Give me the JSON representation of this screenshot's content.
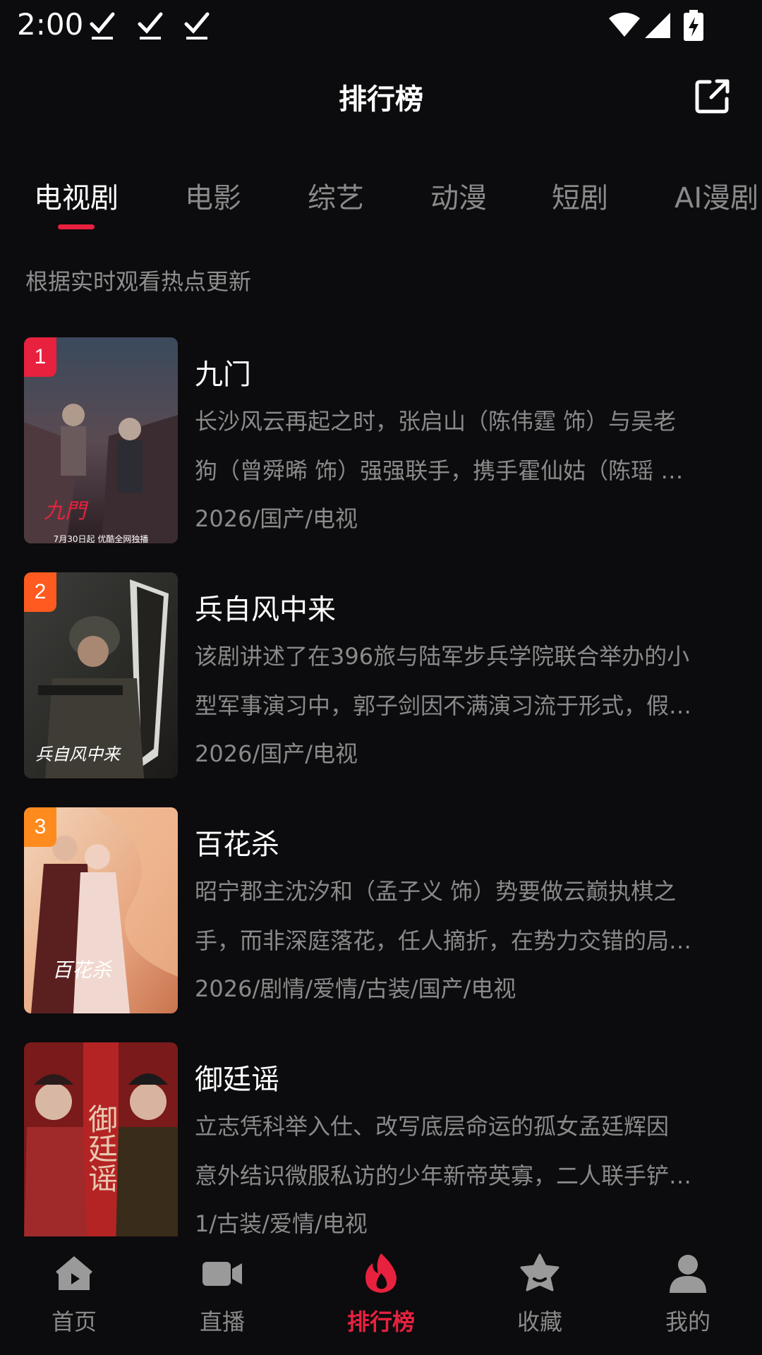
{
  "status_bar": {
    "time": "2:00",
    "icons": [
      "download-done-icon",
      "download-done-icon",
      "download-done-icon",
      "wifi-icon",
      "signal-icon",
      "battery-charging-icon"
    ]
  },
  "header": {
    "title": "排行榜",
    "share_icon": "share-external-icon"
  },
  "tabs": [
    "电视剧",
    "电影",
    "综艺",
    "动漫",
    "短剧",
    "AI漫剧"
  ],
  "active_tab": "电视剧",
  "subtitle": "根据实时观看热点更新",
  "colors": {
    "accent": "#e8213f",
    "background": "#0c0b0d",
    "muted_text": "#8a8a8a",
    "rank_1": "#e8213f",
    "rank_2": "#ff5a1f",
    "rank_3": "#ff8a1e"
  },
  "items": [
    {
      "rank": "1",
      "title": "九门",
      "desc_line1": "长沙风云再起之时，张启山（陈伟霆 饰）与吴老",
      "desc_line2": "狗（曾舜晞 饰）强强联手，携手霍仙姑（陈瑶 …",
      "meta": "2026/国产/电视",
      "poster_text": "九門",
      "poster_caption": "7月30日起 优酷全网独播"
    },
    {
      "rank": "2",
      "title": "兵自风中来",
      "desc_line1": "该剧讲述了在396旅与陆军步兵学院联合举办的小",
      "desc_line2": "型军事演习中，郭子剑因不满演习流于形式，假…",
      "meta": "2026/国产/电视",
      "poster_text": "兵自风中来"
    },
    {
      "rank": "3",
      "title": "百花杀",
      "desc_line1": "昭宁郡主沈汐和（孟子义 饰）势要做云巅执棋之",
      "desc_line2": "手，而非深庭落花，任人摘折，在势力交错的局…",
      "meta": "2026/剧情/爱情/古装/国产/电视",
      "poster_text": "百花杀"
    },
    {
      "rank": "",
      "title": "御廷谣",
      "desc_line1": "立志凭科举入仕、改写底层命运的孤女孟廷辉因",
      "desc_line2": "意外结识微服私访的少年新帝英寡，二人联手铲…",
      "meta": "1/古装/爱情/电视",
      "poster_text": "御廷谣"
    }
  ],
  "bottom_nav": [
    {
      "label": "首页",
      "icon": "home-play-icon"
    },
    {
      "label": "直播",
      "icon": "video-camera-icon"
    },
    {
      "label": "排行榜",
      "icon": "flame-icon"
    },
    {
      "label": "收藏",
      "icon": "star-icon"
    },
    {
      "label": "我的",
      "icon": "user-icon"
    }
  ],
  "active_nav": "排行榜"
}
